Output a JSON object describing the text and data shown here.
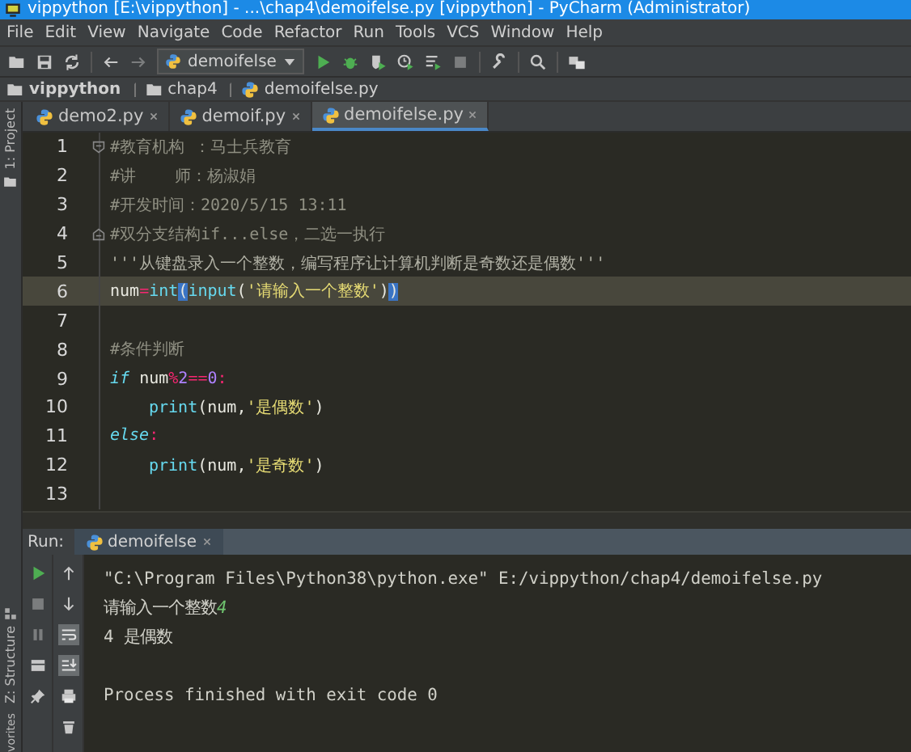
{
  "window": {
    "title": "vippython [E:\\vippython] - ...\\chap4\\demoifelse.py [vippython] - PyCharm (Administrator)"
  },
  "menu": [
    "File",
    "Edit",
    "View",
    "Navigate",
    "Code",
    "Refactor",
    "Run",
    "Tools",
    "VCS",
    "Window",
    "Help"
  ],
  "toolbar": [
    {
      "kind": "open",
      "disabled": false
    },
    {
      "kind": "save",
      "disabled": false
    },
    {
      "kind": "sync",
      "disabled": false
    },
    {
      "kind": "sep"
    },
    {
      "kind": "back",
      "disabled": false
    },
    {
      "kind": "forward",
      "disabled": true
    },
    {
      "kind": "config",
      "label": "demoifelse"
    },
    {
      "kind": "run",
      "disabled": false
    },
    {
      "kind": "debug",
      "disabled": false
    },
    {
      "kind": "coverage",
      "disabled": false
    },
    {
      "kind": "profile",
      "disabled": false
    },
    {
      "kind": "concurrency",
      "disabled": false
    },
    {
      "kind": "stop",
      "disabled": true
    },
    {
      "kind": "sep"
    },
    {
      "kind": "wrench",
      "disabled": false
    },
    {
      "kind": "sep"
    },
    {
      "kind": "search",
      "disabled": false
    },
    {
      "kind": "sep"
    },
    {
      "kind": "more",
      "disabled": false
    }
  ],
  "breadcrumb": [
    {
      "kind": "folder",
      "label": "vippython"
    },
    {
      "kind": "folder",
      "label": "chap4"
    },
    {
      "kind": "python",
      "label": "demoifelse.py"
    }
  ],
  "side_labels": [
    {
      "label": "1: Project",
      "kind": "folder"
    },
    {
      "label": "Z: Structure",
      "kind": "structure"
    },
    {
      "label": "vorites",
      "kind": "none"
    }
  ],
  "tabs": [
    {
      "label": "demo2.py",
      "selected": false
    },
    {
      "label": "demoif.py",
      "selected": false
    },
    {
      "label": "demoifelse.py",
      "selected": true
    }
  ],
  "editor": {
    "lines": [
      {
        "number": "1",
        "fold_start": true,
        "current": false,
        "tokens": [
          {
            "kind": "comment",
            "text": "#教育机构 ：马士兵教育"
          }
        ]
      },
      {
        "number": "2",
        "current": false,
        "tokens": [
          {
            "kind": "comment",
            "text": "#讲    师：杨淑娟"
          }
        ]
      },
      {
        "number": "3",
        "current": false,
        "tokens": [
          {
            "kind": "comment",
            "text": "#开发时间：2020/5/15 13:11"
          }
        ]
      },
      {
        "number": "4",
        "fold_end": true,
        "current": false,
        "tokens": [
          {
            "kind": "comment",
            "text": "#双分支结构if...else，二选一执行"
          }
        ]
      },
      {
        "number": "5",
        "current": false,
        "tokens": [
          {
            "kind": "docstring",
            "text": "'''从键盘录入一个整数，编写程序让计算机判断是奇数还是偶数'''"
          }
        ]
      },
      {
        "number": "6",
        "current": true,
        "tokens": [
          {
            "kind": "plain",
            "text": "num"
          },
          {
            "kind": "op",
            "text": "="
          },
          {
            "kind": "builtin",
            "text": "int"
          },
          {
            "kind": "match",
            "text": "("
          },
          {
            "kind": "builtin",
            "text": "input"
          },
          {
            "kind": "plain",
            "text": "("
          },
          {
            "kind": "string",
            "text": "'请输入一个整数'"
          },
          {
            "kind": "plain",
            "text": ")"
          },
          {
            "kind": "match",
            "text": ")"
          }
        ]
      },
      {
        "number": "7",
        "current": false
      },
      {
        "number": "8",
        "current": false,
        "tokens": [
          {
            "kind": "comment",
            "text": "#条件判断"
          }
        ]
      },
      {
        "number": "9",
        "current": false,
        "tokens": [
          {
            "kind": "keyword",
            "text": "if"
          },
          {
            "kind": "plain",
            "text": " num"
          },
          {
            "kind": "op",
            "text": "%"
          },
          {
            "kind": "number",
            "text": "2"
          },
          {
            "kind": "op",
            "text": "=="
          },
          {
            "kind": "number",
            "text": "0"
          },
          {
            "kind": "op",
            "text": ":"
          }
        ]
      },
      {
        "number": "10",
        "current": false,
        "tokens": [
          {
            "kind": "indent"
          },
          {
            "kind": "builtin",
            "text": "print"
          },
          {
            "kind": "plain",
            "text": "(num,"
          },
          {
            "kind": "string",
            "text": "'是偶数'"
          },
          {
            "kind": "plain",
            "text": ")"
          }
        ]
      },
      {
        "number": "11",
        "current": false,
        "tokens": [
          {
            "kind": "keyword",
            "text": "else"
          },
          {
            "kind": "op",
            "text": ":"
          }
        ]
      },
      {
        "number": "12",
        "current": false,
        "tokens": [
          {
            "kind": "indent"
          },
          {
            "kind": "builtin",
            "text": "print"
          },
          {
            "kind": "plain",
            "text": "(num,"
          },
          {
            "kind": "string",
            "text": "'是奇数'"
          },
          {
            "kind": "plain",
            "text": ")"
          }
        ]
      },
      {
        "number": "13",
        "current": false
      }
    ]
  },
  "run": {
    "label": "Run:",
    "tab": "demoifelse",
    "tools_left": [
      {
        "kind": "run",
        "disabled": false
      },
      {
        "kind": "stop",
        "disabled": true
      },
      {
        "kind": "pause",
        "disabled": true
      },
      {
        "kind": "layout",
        "disabled": false
      },
      {
        "kind": "pin",
        "disabled": false
      }
    ],
    "tools_right": [
      {
        "kind": "up",
        "on": false
      },
      {
        "kind": "down",
        "on": false
      },
      {
        "kind": "wrap",
        "on": true
      },
      {
        "kind": "scroll-end",
        "on": true
      },
      {
        "kind": "print",
        "on": false
      },
      {
        "kind": "trash",
        "on": false
      }
    ],
    "output": [
      {
        "kind": "text",
        "segments": [
          {
            "kind": "out",
            "text": "\"C:\\Program Files\\Python38\\python.exe\" E:/vippython/chap4/demoifelse.py"
          }
        ]
      },
      {
        "kind": "text",
        "segments": [
          {
            "kind": "out",
            "text": "请输入一个整数"
          },
          {
            "kind": "input",
            "text": "4"
          }
        ]
      },
      {
        "kind": "text",
        "segments": [
          {
            "kind": "out",
            "text": "4 是偶数"
          }
        ]
      },
      {
        "kind": "blank"
      },
      {
        "kind": "text",
        "segments": [
          {
            "kind": "out",
            "text": "Process finished with exit code 0"
          }
        ]
      }
    ]
  }
}
